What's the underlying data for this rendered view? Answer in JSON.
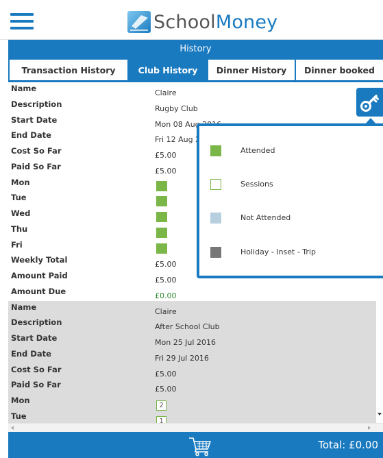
{
  "app": {
    "logo_part1": "School",
    "logo_part2": "Money"
  },
  "title_bar": "History",
  "tabs": [
    {
      "label": "Transaction History",
      "active": false
    },
    {
      "label": "Club History",
      "active": true
    },
    {
      "label": "Dinner History",
      "active": false
    },
    {
      "label": "Dinner booked",
      "active": false
    }
  ],
  "records": [
    {
      "fields": [
        {
          "label": "Name",
          "value": "Claire"
        },
        {
          "label": "Description",
          "value": "Rugby Club"
        },
        {
          "label": "Start Date",
          "value": "Mon 08 Aug 2016"
        },
        {
          "label": "End Date",
          "value": "Fri 12 Aug 2016"
        },
        {
          "label": "Cost So Far",
          "value": "£5.00"
        },
        {
          "label": "Paid So Far",
          "value": "£5.00"
        },
        {
          "label": "Mon",
          "status": "attended"
        },
        {
          "label": "Tue",
          "status": "attended"
        },
        {
          "label": "Wed",
          "status": "attended"
        },
        {
          "label": "Thu",
          "status": "attended"
        },
        {
          "label": "Fri",
          "status": "attended"
        },
        {
          "label": "Weekly Total",
          "value": "£5.00"
        },
        {
          "label": "Amount Paid",
          "value": "£5.00"
        },
        {
          "label": "Amount Due",
          "value": "£0.00"
        }
      ]
    },
    {
      "fields": [
        {
          "label": "Name",
          "value": "Claire"
        },
        {
          "label": "Description",
          "value": "After School Club"
        },
        {
          "label": "Start Date",
          "value": "Mon 25 Jul 2016"
        },
        {
          "label": "End Date",
          "value": "Fri 29 Jul 2016"
        },
        {
          "label": "Cost So Far",
          "value": "£5.00"
        },
        {
          "label": "Paid So Far",
          "value": "£5.00"
        },
        {
          "label": "Mon",
          "sessions": "2"
        },
        {
          "label": "Tue",
          "sessions": "1"
        }
      ]
    }
  ],
  "legend": [
    {
      "label": "Attended",
      "color": "#7ab648",
      "style": "filled"
    },
    {
      "label": "Sessions",
      "color": "#7ab648",
      "style": "outline"
    },
    {
      "label": "Not Attended",
      "color": "#b8cfe0",
      "style": "filled"
    },
    {
      "label": "Holiday - Inset - Trip",
      "color": "#777777",
      "style": "filled"
    }
  ],
  "footer": {
    "total": "Total: £0.00",
    "cart_icon": "shopping-cart-icon"
  },
  "icons": {
    "menu": "hamburger-menu-icon",
    "key": "key-icon"
  },
  "colors": {
    "brand_blue": "#1a7ac0",
    "attended_green": "#7ab648",
    "grey_record": "#dcdcdc"
  }
}
